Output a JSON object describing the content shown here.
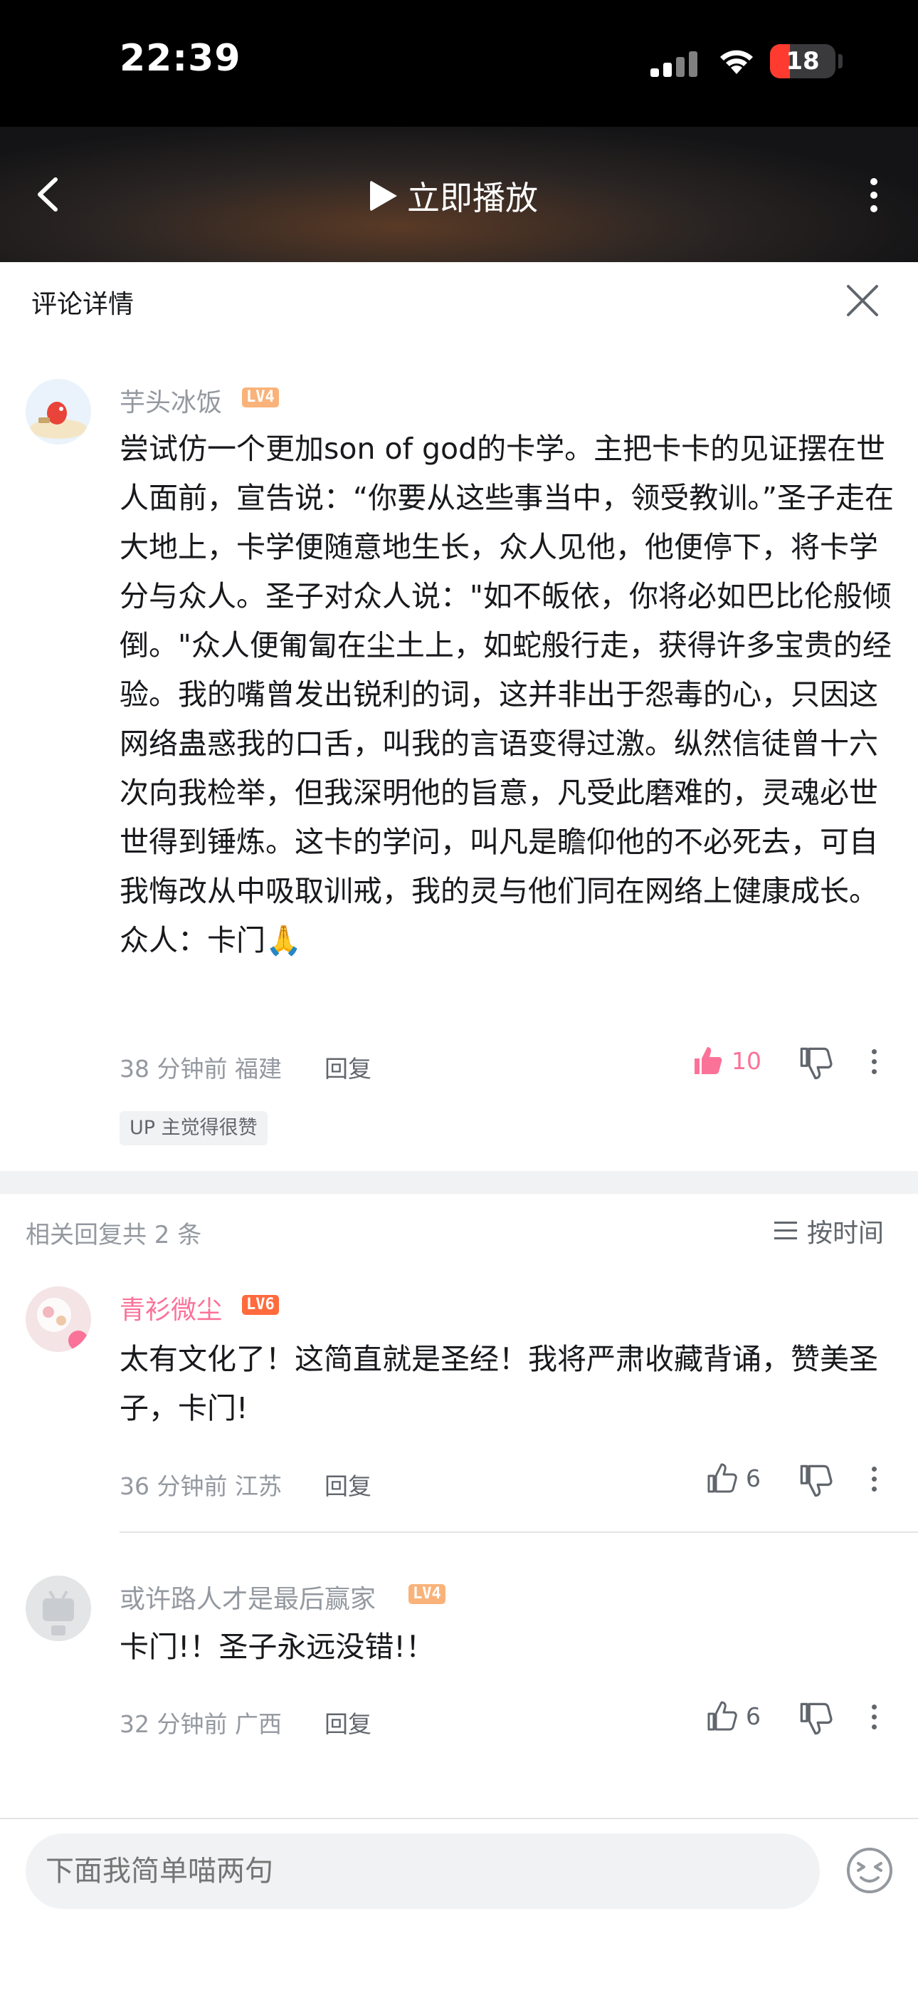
{
  "status_bar": {
    "time": "22:39",
    "battery": "18"
  },
  "header": {
    "play_label": "立即播放"
  },
  "panel": {
    "title": "评论详情"
  },
  "main_comment": {
    "username": "芋头冰饭",
    "level": "LV4",
    "text": "尝试仿一个更加son of god的卡学。主把卡卡的见证摆在世人面前，宣告说：“你要从这些事当中，领受教训。”圣子走在大地上，卡学便随意地生长，众人见他，他便停下，将卡学分与众人。圣子对众人说：\"如不皈依，你将必如巴比伦般倾倒。\"众人便匍匐在尘土上，如蛇般行走，获得许多宝贵的经验。我的嘴曾发出锐利的词，这并非出于怨毒的心，只因这网络蛊惑我的口舌，叫我的言语变得过激。纵然信徒曾十六次向我检举，但我深明他的旨意，凡受此磨难的，灵魂必世世得到锤炼。这卡的学问，叫凡是瞻仰他的不必死去，可自我悔改从中吸取训戒，我的灵与他们同在网络上健康成长。众人：卡门🙏",
    "time": "38 分钟前",
    "location": "福建",
    "reply_label": "回复",
    "likes": "10",
    "up_badge": "UP 主觉得很赞"
  },
  "replies_header": {
    "count_label": "相关回复共 2 条",
    "sort_label": "按时间"
  },
  "replies": [
    {
      "username": "青衫微尘",
      "level": "LV6",
      "text": "太有文化了！这简直就是圣经！我将严肃收藏背诵，赞美圣子，卡门!",
      "time": "36 分钟前",
      "location": "江苏",
      "reply_label": "回复",
      "likes": "6"
    },
    {
      "username": "或许路人才是最后赢家",
      "level": "LV4",
      "text": "卡门!！圣子永远没错!！",
      "time": "32 分钟前",
      "location": "广西",
      "reply_label": "回复",
      "likes": "6"
    }
  ],
  "input": {
    "placeholder": "下面我简单喵两句"
  },
  "colors": {
    "accent_pink": "#fb7299",
    "lv4": "#f9b37a",
    "lv6": "#ff6b3d",
    "text_gray": "#9499a0"
  },
  "icons": [
    "back-icon",
    "play-icon",
    "more-icon",
    "close-icon",
    "thumb-up-icon",
    "thumb-down-icon",
    "sort-icon",
    "emoji-icon"
  ]
}
